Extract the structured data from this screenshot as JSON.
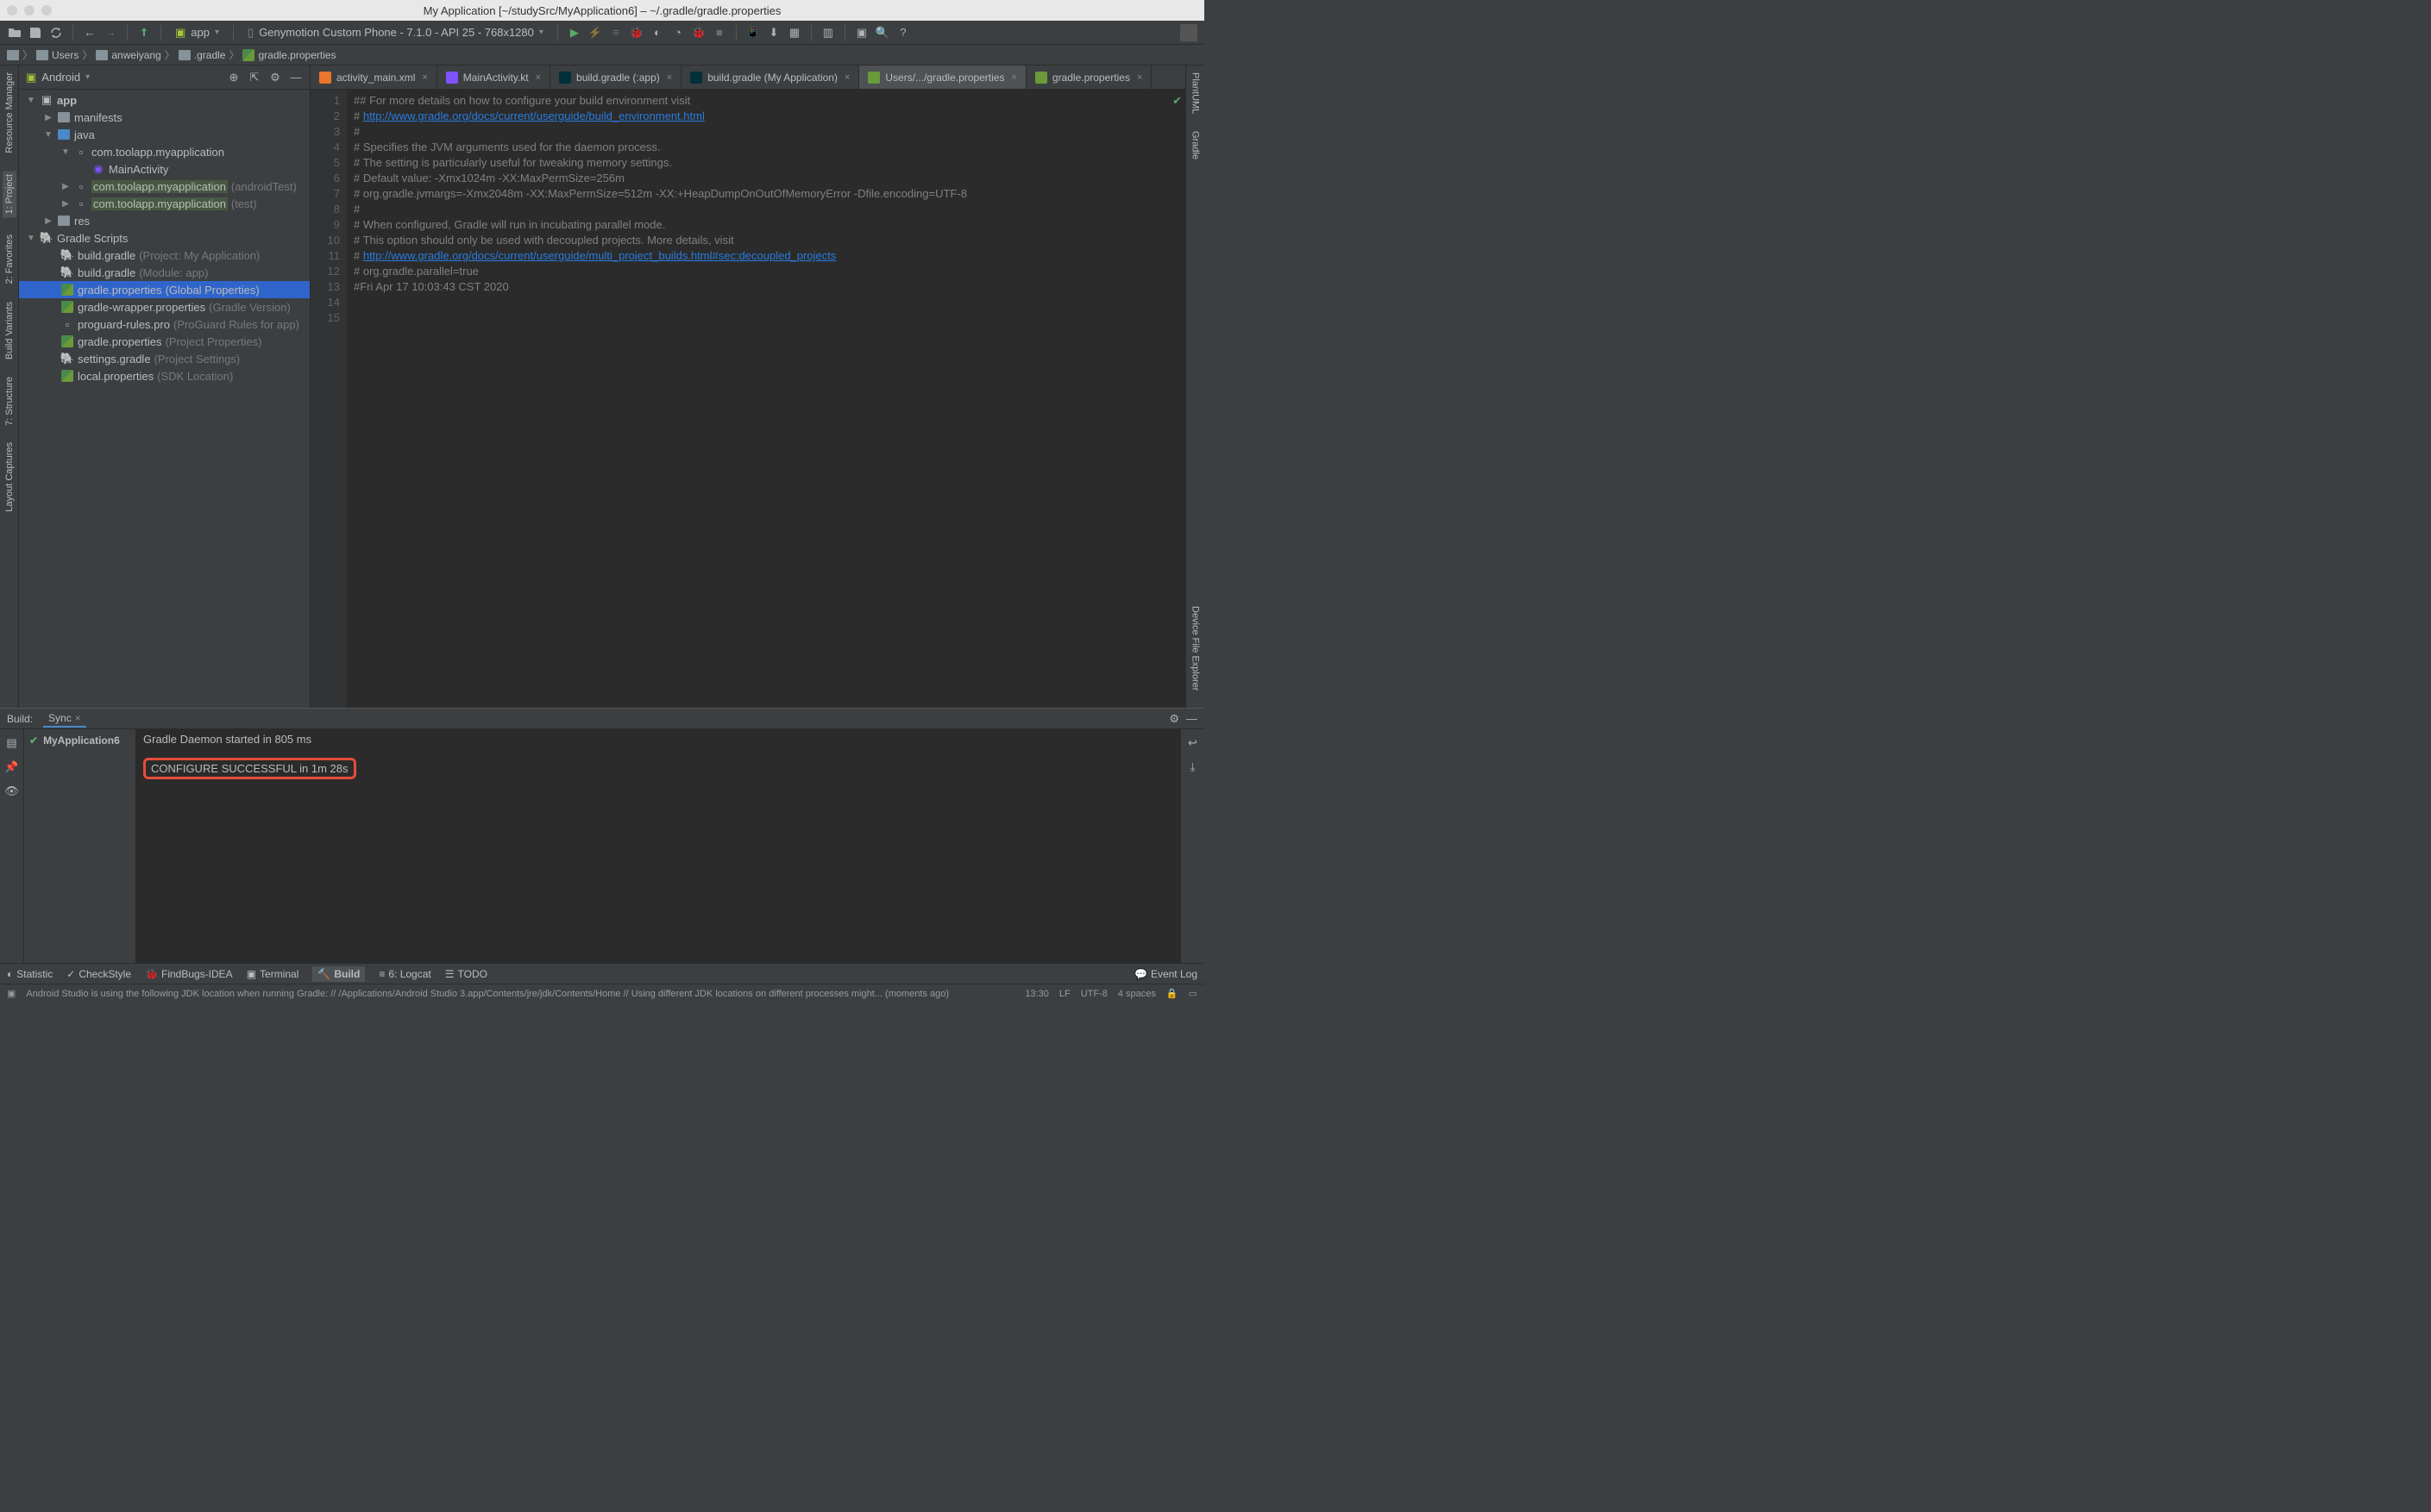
{
  "window_title": "My Application [~/studySrc/MyApplication6] – ~/.gradle/gradle.properties",
  "toolbar": {
    "config_app": "app",
    "device": "Genymotion Custom Phone - 7.1.0 - API 25 - 768x1280"
  },
  "breadcrumb": [
    "Users",
    "anweiyang",
    ".gradle",
    "gradle.properties"
  ],
  "project_panel": {
    "mode": "Android",
    "tree": {
      "app": "app",
      "manifests": "manifests",
      "java": "java",
      "pkg1": "com.toolapp.myapplication",
      "main_activity": "MainActivity",
      "pkg2": "com.toolapp.myapplication",
      "pkg2_hint": "(androidTest)",
      "pkg3": "com.toolapp.myapplication",
      "pkg3_hint": "(test)",
      "res": "res",
      "gradle_scripts": "Gradle Scripts",
      "bg1": "build.gradle",
      "bg1_hint": "(Project: My Application)",
      "bg2": "build.gradle",
      "bg2_hint": "(Module: app)",
      "gp1": "gradle.properties",
      "gp1_hint": "(Global Properties)",
      "gwp": "gradle-wrapper.properties",
      "gwp_hint": "(Gradle Version)",
      "pro": "proguard-rules.pro",
      "pro_hint": "(ProGuard Rules for app)",
      "gp2": "gradle.properties",
      "gp2_hint": "(Project Properties)",
      "sg": "settings.gradle",
      "sg_hint": "(Project Settings)",
      "lp": "local.properties",
      "lp_hint": "(SDK Location)"
    }
  },
  "tabs": [
    {
      "label": "activity_main.xml",
      "icon": "xml"
    },
    {
      "label": "MainActivity.kt",
      "icon": "kotlin"
    },
    {
      "label": "build.gradle (:app)",
      "icon": "gradle"
    },
    {
      "label": "build.gradle (My Application)",
      "icon": "gradle"
    },
    {
      "label": "Users/.../gradle.properties",
      "icon": "props",
      "active": true
    },
    {
      "label": "gradle.properties",
      "icon": "props"
    }
  ],
  "editor": {
    "lines": [
      "## For more details on how to configure your build environment visit",
      "# ",
      "#",
      "# Specifies the JVM arguments used for the daemon process.",
      "# The setting is particularly useful for tweaking memory settings.",
      "# Default value: -Xmx1024m -XX:MaxPermSize=256m",
      "# org.gradle.jvmargs=-Xmx2048m -XX:MaxPermSize=512m -XX:+HeapDumpOnOutOfMemoryError -Dfile.encoding=UTF-8",
      "#",
      "# When configured, Gradle will run in incubating parallel mode.",
      "# This option should only be used with decoupled projects. More details, visit",
      "# ",
      "# org.gradle.parallel=true",
      "#Fri Apr 17 10:03:43 CST 2020",
      "",
      ""
    ],
    "link1": "http://www.gradle.org/docs/current/userguide/build_environment.html",
    "link2": "http://www.gradle.org/docs/current/userguide/multi_project_builds.html#sec:decoupled_projects"
  },
  "build": {
    "label": "Build:",
    "tab": "Sync",
    "tree_item": "MyApplication6",
    "output_line1": "Gradle Daemon started in 805 ms",
    "output_line2": "CONFIGURE SUCCESSFUL in 1m 28s"
  },
  "left_rail": [
    "Resource Manager",
    "1: Project",
    "2: Favorites",
    "Build Variants",
    "7: Structure",
    "Layout Captures"
  ],
  "right_rail": [
    "PlantUML",
    "Gradle",
    "Device File Explorer"
  ],
  "bottom_bar": {
    "statistic": "Statistic",
    "checkstyle": "CheckStyle",
    "findbugs": "FindBugs-IDEA",
    "terminal": "Terminal",
    "build": "Build",
    "logcat": "6: Logcat",
    "todo": "TODO",
    "event_log": "Event Log"
  },
  "status": {
    "message": "Android Studio is using the following JDK location when running Gradle: // /Applications/Android Studio 3.app/Contents/jre/jdk/Contents/Home // Using different JDK locations on different processes might... (moments ago)",
    "cursor": "13:30",
    "line_sep": "LF",
    "encoding": "UTF-8",
    "indent": "4 spaces"
  }
}
